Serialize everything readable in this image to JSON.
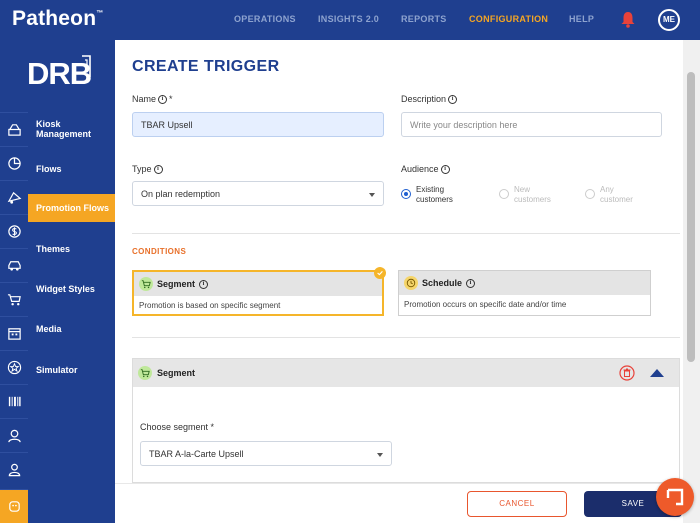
{
  "colors": {
    "brand": "#1f3f8f",
    "accent": "#f5a623",
    "danger": "#e8562e",
    "section": "#e8702a"
  },
  "app": {
    "name": "Patheon",
    "trademark": "™",
    "brand_logo": "DRB"
  },
  "nav": {
    "items": [
      {
        "label": "OPERATIONS",
        "active": false
      },
      {
        "label": "INSIGHTS 2.0",
        "active": false
      },
      {
        "label": "REPORTS",
        "active": false
      },
      {
        "label": "CONFIGURATION",
        "active": true
      },
      {
        "label": "HELP",
        "active": false
      }
    ],
    "notification_icon": "bell-icon",
    "user_initials": "ME"
  },
  "rail_icons": [
    "kiosk-icon",
    "pie-chart-icon",
    "promotion-icon",
    "dollar-badge-icon",
    "car-icon",
    "cart-icon",
    "calendar-icon",
    "star-icon",
    "barcode-icon",
    "support-agent-icon",
    "user-icon",
    "face-icon"
  ],
  "menu": {
    "items": [
      {
        "label": "Kiosk Management",
        "active": false
      },
      {
        "label": "Flows",
        "active": false
      },
      {
        "label": "Promotion Flows",
        "active": true
      },
      {
        "label": "Themes",
        "active": false
      },
      {
        "label": "Widget Styles",
        "active": false
      },
      {
        "label": "Media",
        "active": false
      },
      {
        "label": "Simulator",
        "active": false
      }
    ]
  },
  "form": {
    "title": "CREATE TRIGGER",
    "name_label": "Name",
    "name_required": "*",
    "name_value": "TBAR Upsell",
    "description_label": "Description",
    "description_placeholder": "Write your description here",
    "type_label": "Type",
    "type_value": "On plan redemption",
    "audience_label": "Audience",
    "audience_options": [
      {
        "line1": "Existing",
        "line2": "customers",
        "checked": true,
        "disabled": false
      },
      {
        "line1": "New",
        "line2": "customers",
        "checked": false,
        "disabled": true
      },
      {
        "line1": "Any",
        "line2": "customer",
        "checked": false,
        "disabled": true
      }
    ]
  },
  "conditions": {
    "heading": "CONDITIONS",
    "cards": [
      {
        "title": "Segment",
        "description": "Promotion is based on specific segment",
        "selected": true,
        "icon": "cart-icon"
      },
      {
        "title": "Schedule",
        "description": "Promotion occurs on specific date and/or time",
        "selected": false,
        "icon": "clock-icon"
      }
    ]
  },
  "segment_panel": {
    "title": "Segment",
    "choose_label": "Choose segment *",
    "segment_value": "TBAR A-la-Carte Upsell"
  },
  "actions": {
    "cancel": "CANCEL",
    "save": "SAVE"
  }
}
